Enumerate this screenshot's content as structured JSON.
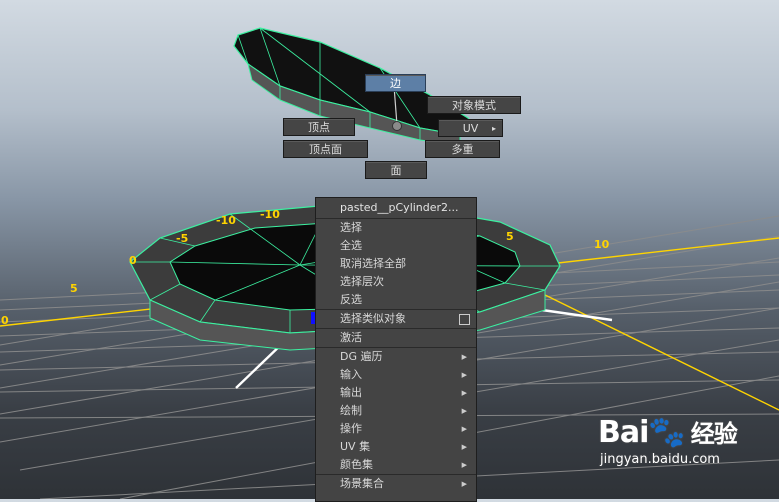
{
  "marking_menu": {
    "north": "边",
    "east_top": "对象模式",
    "west": "顶点",
    "east": "UV",
    "southwest": "顶点面",
    "southeast": "多重",
    "south": "面"
  },
  "context_menu": {
    "title": "pasted__pCylinder2...",
    "items": [
      {
        "label": "选择"
      },
      {
        "label": "全选"
      },
      {
        "label": "取消选择全部"
      },
      {
        "label": "选择层次"
      },
      {
        "label": "反选"
      },
      {
        "label": "选择类似对象",
        "option_box": true
      },
      {
        "label": "激活"
      },
      {
        "label": "DG 遍历",
        "submenu": true
      },
      {
        "label": "输入",
        "submenu": true
      },
      {
        "label": "输出",
        "submenu": true
      },
      {
        "label": "绘制",
        "submenu": true
      },
      {
        "label": "操作",
        "submenu": true
      },
      {
        "label": "UV 集",
        "submenu": true
      },
      {
        "label": "颜色集",
        "submenu": true
      },
      {
        "label": "场景集合",
        "submenu": true
      }
    ]
  },
  "grid_labels": {
    "l1": "-10",
    "l2": "-10",
    "l3": "-5",
    "l4": "0",
    "l5": "5",
    "l6": "0",
    "l7": "5",
    "l8": "10"
  },
  "watermark": {
    "logo": "Bai",
    "logo_cn": "经验",
    "url": "jingyan.baidu.com"
  },
  "colors": {
    "wireframe": "#3cf0a0",
    "grid_axis": "#ffd400",
    "menu_bg": "#444444",
    "active_item": "#5d7fa6"
  }
}
